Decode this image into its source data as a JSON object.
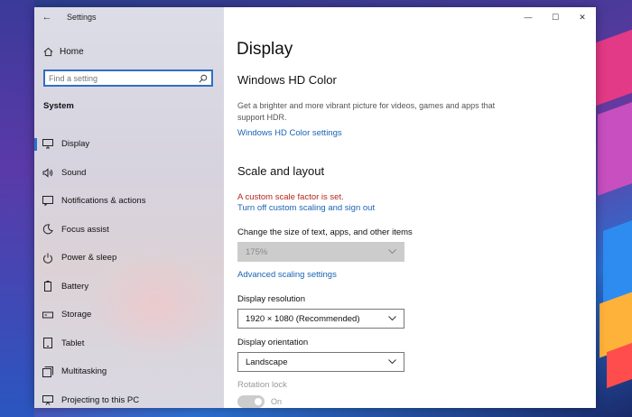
{
  "window": {
    "title": "Settings"
  },
  "controls": {
    "back": "←",
    "minimize": "—",
    "maximize": "☐",
    "close": "✕"
  },
  "sidebar": {
    "home_label": "Home",
    "search_placeholder": "Find a setting",
    "section_label": "System",
    "items": [
      {
        "label": "Display",
        "icon": "monitor-icon",
        "active": true
      },
      {
        "label": "Sound",
        "icon": "speaker-icon"
      },
      {
        "label": "Notifications & actions",
        "icon": "notification-icon"
      },
      {
        "label": "Focus assist",
        "icon": "moon-icon"
      },
      {
        "label": "Power & sleep",
        "icon": "power-icon"
      },
      {
        "label": "Battery",
        "icon": "battery-icon"
      },
      {
        "label": "Storage",
        "icon": "storage-icon"
      },
      {
        "label": "Tablet",
        "icon": "tablet-icon"
      },
      {
        "label": "Multitasking",
        "icon": "multitasking-icon"
      },
      {
        "label": "Projecting to this PC",
        "icon": "projecting-icon"
      }
    ]
  },
  "main": {
    "title": "Display",
    "hd_color": {
      "heading": "Windows HD Color",
      "description": "Get a brighter and more vibrant picture for videos, games and apps that support HDR.",
      "link": "Windows HD Color settings"
    },
    "scale": {
      "heading": "Scale and layout",
      "warning": "A custom scale factor is set.",
      "turn_off_link": "Turn off custom scaling and sign out",
      "size_label": "Change the size of text, apps, and other items",
      "size_value": "175%",
      "advanced_link": "Advanced scaling settings",
      "resolution_label": "Display resolution",
      "resolution_value": "1920 × 1080 (Recommended)",
      "orientation_label": "Display orientation",
      "orientation_value": "Landscape",
      "rotation_label": "Rotation lock",
      "rotation_state": "On"
    }
  },
  "colors": {
    "accent": "#2f6fc4",
    "link": "#1a64b4",
    "warning": "#b3261e"
  }
}
